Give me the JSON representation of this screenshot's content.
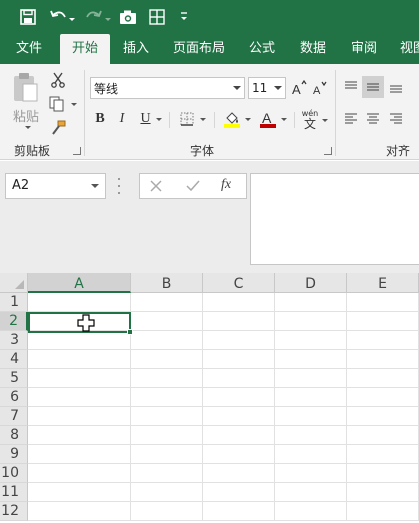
{
  "quick_access": {
    "save": "save-icon",
    "undo": "undo-icon",
    "redo": "redo-icon",
    "camera": "camera-icon",
    "borders": "borders-icon",
    "customize": "customize-icon"
  },
  "tabs": [
    {
      "label": "文件"
    },
    {
      "label": "开始",
      "active": true
    },
    {
      "label": "插入"
    },
    {
      "label": "页面布局"
    },
    {
      "label": "公式"
    },
    {
      "label": "数据"
    },
    {
      "label": "审阅"
    },
    {
      "label": "视图"
    }
  ],
  "ribbon": {
    "clipboard": {
      "paste_label": "粘贴",
      "group_label": "剪贴板"
    },
    "font": {
      "font_name": "等线",
      "font_size": "11",
      "group_label": "字体",
      "wen_label": "wén",
      "wen_char": "文"
    },
    "alignment": {
      "group_label": "对齐方式"
    }
  },
  "formula_bar": {
    "name_box": "A2",
    "fx_label": "fx",
    "formula": ""
  },
  "grid": {
    "columns": [
      "A",
      "B",
      "C",
      "D",
      "E"
    ],
    "rows": [
      "1",
      "2",
      "3",
      "4",
      "5",
      "6",
      "7",
      "8",
      "9",
      "10",
      "11",
      "12"
    ],
    "selected_cell": "A2",
    "selected_column": "A",
    "selected_row": "2"
  },
  "colors": {
    "accent": "#217346",
    "font_color": "#c00000",
    "highlight_color": "#ffff00"
  }
}
